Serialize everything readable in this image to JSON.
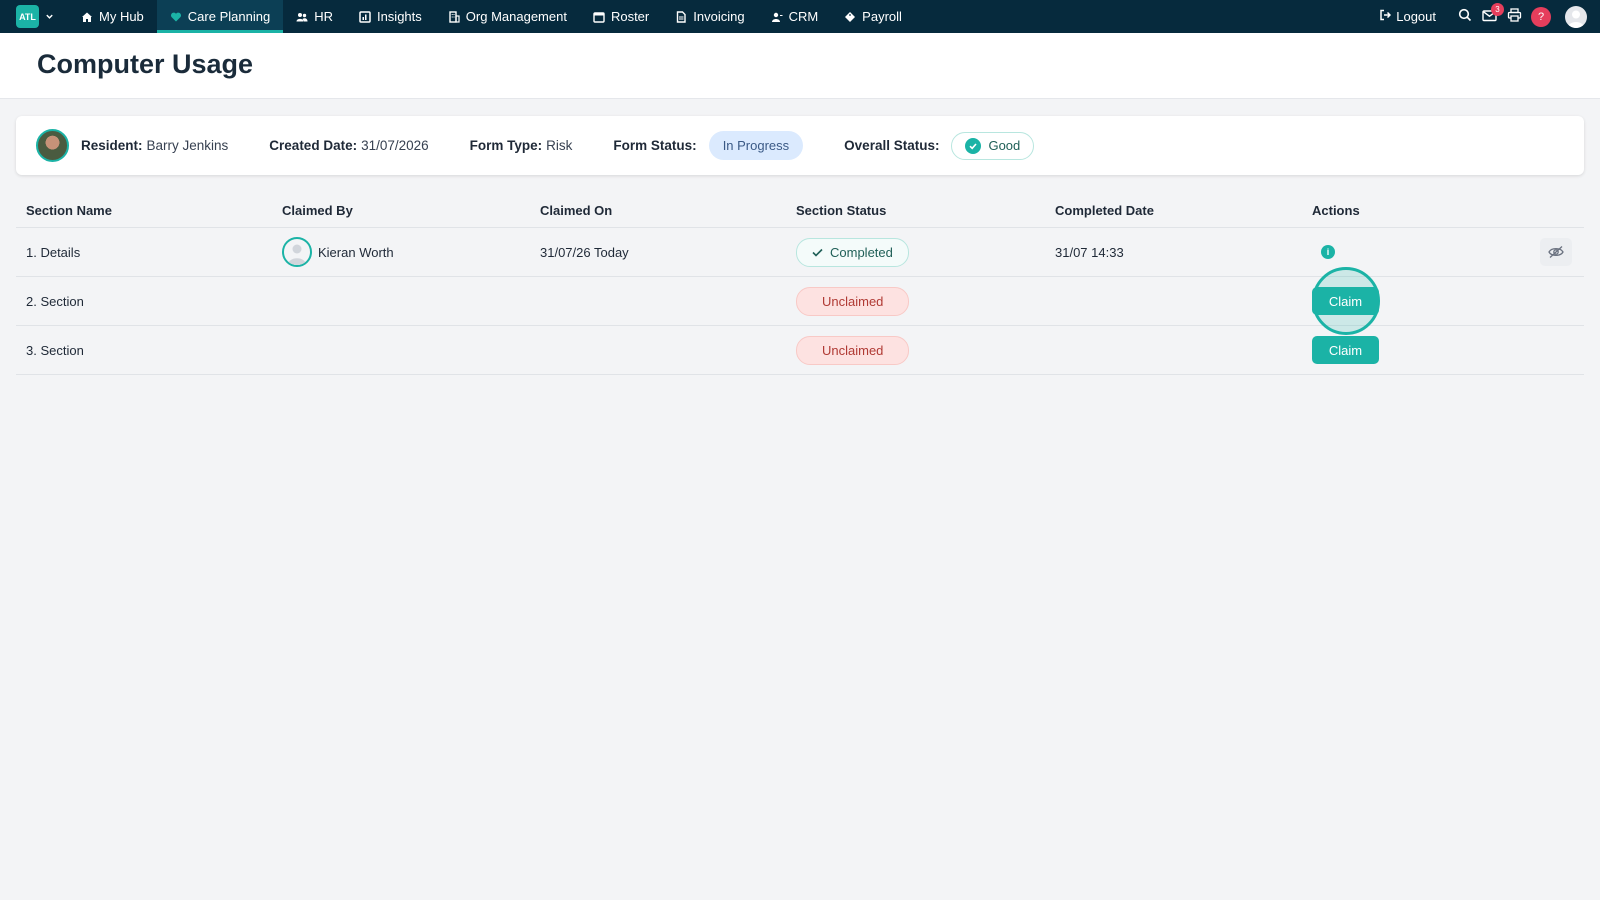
{
  "brand": {
    "logo_text": "ATL"
  },
  "nav": {
    "items": [
      {
        "label": "My Hub",
        "icon": "home-icon",
        "active": false
      },
      {
        "label": "Care Planning",
        "icon": "heart-icon",
        "active": true
      },
      {
        "label": "HR",
        "icon": "people-icon",
        "active": false
      },
      {
        "label": "Insights",
        "icon": "chart-icon",
        "active": false
      },
      {
        "label": "Org Management",
        "icon": "building-icon",
        "active": false
      },
      {
        "label": "Roster",
        "icon": "calendar-icon",
        "active": false
      },
      {
        "label": "Invoicing",
        "icon": "document-icon",
        "active": false
      },
      {
        "label": "CRM",
        "icon": "contacts-icon",
        "active": false
      },
      {
        "label": "Payroll",
        "icon": "tag-icon",
        "active": false
      }
    ],
    "logout_label": "Logout",
    "mail_count": "3",
    "help_label": "?"
  },
  "page": {
    "title": "Computer Usage"
  },
  "info": {
    "resident_label": "Resident:",
    "resident_name": "Barry Jenkins",
    "created_label": "Created Date:",
    "created_value": "31/07/2026",
    "form_type_label": "Form Type:",
    "form_type_value": "Risk",
    "form_status_label": "Form Status:",
    "form_status_value": "In Progress",
    "overall_label": "Overall Status:",
    "overall_value": "Good"
  },
  "table": {
    "headers": {
      "section_name": "Section Name",
      "claimed_by": "Claimed By",
      "claimed_on": "Claimed On",
      "section_status": "Section Status",
      "completed_date": "Completed Date",
      "actions": "Actions"
    },
    "rows": [
      {
        "section": "1. Details",
        "claimed_by": "Kieran Worth",
        "claimed_on": "31/07/26 Today",
        "status": "Completed",
        "completed_date": "31/07 14:33"
      },
      {
        "section": "2. Section",
        "status": "Unclaimed",
        "action_label": "Claim"
      },
      {
        "section": "3. Section",
        "status": "Unclaimed",
        "action_label": "Claim"
      }
    ]
  },
  "colors": {
    "nav_bg": "#062a3d",
    "accent": "#1bb3a6",
    "unclaimed_bg": "#fde2e1",
    "unclaimed_text": "#b03a34",
    "in_progress_bg": "#dbeafe"
  }
}
